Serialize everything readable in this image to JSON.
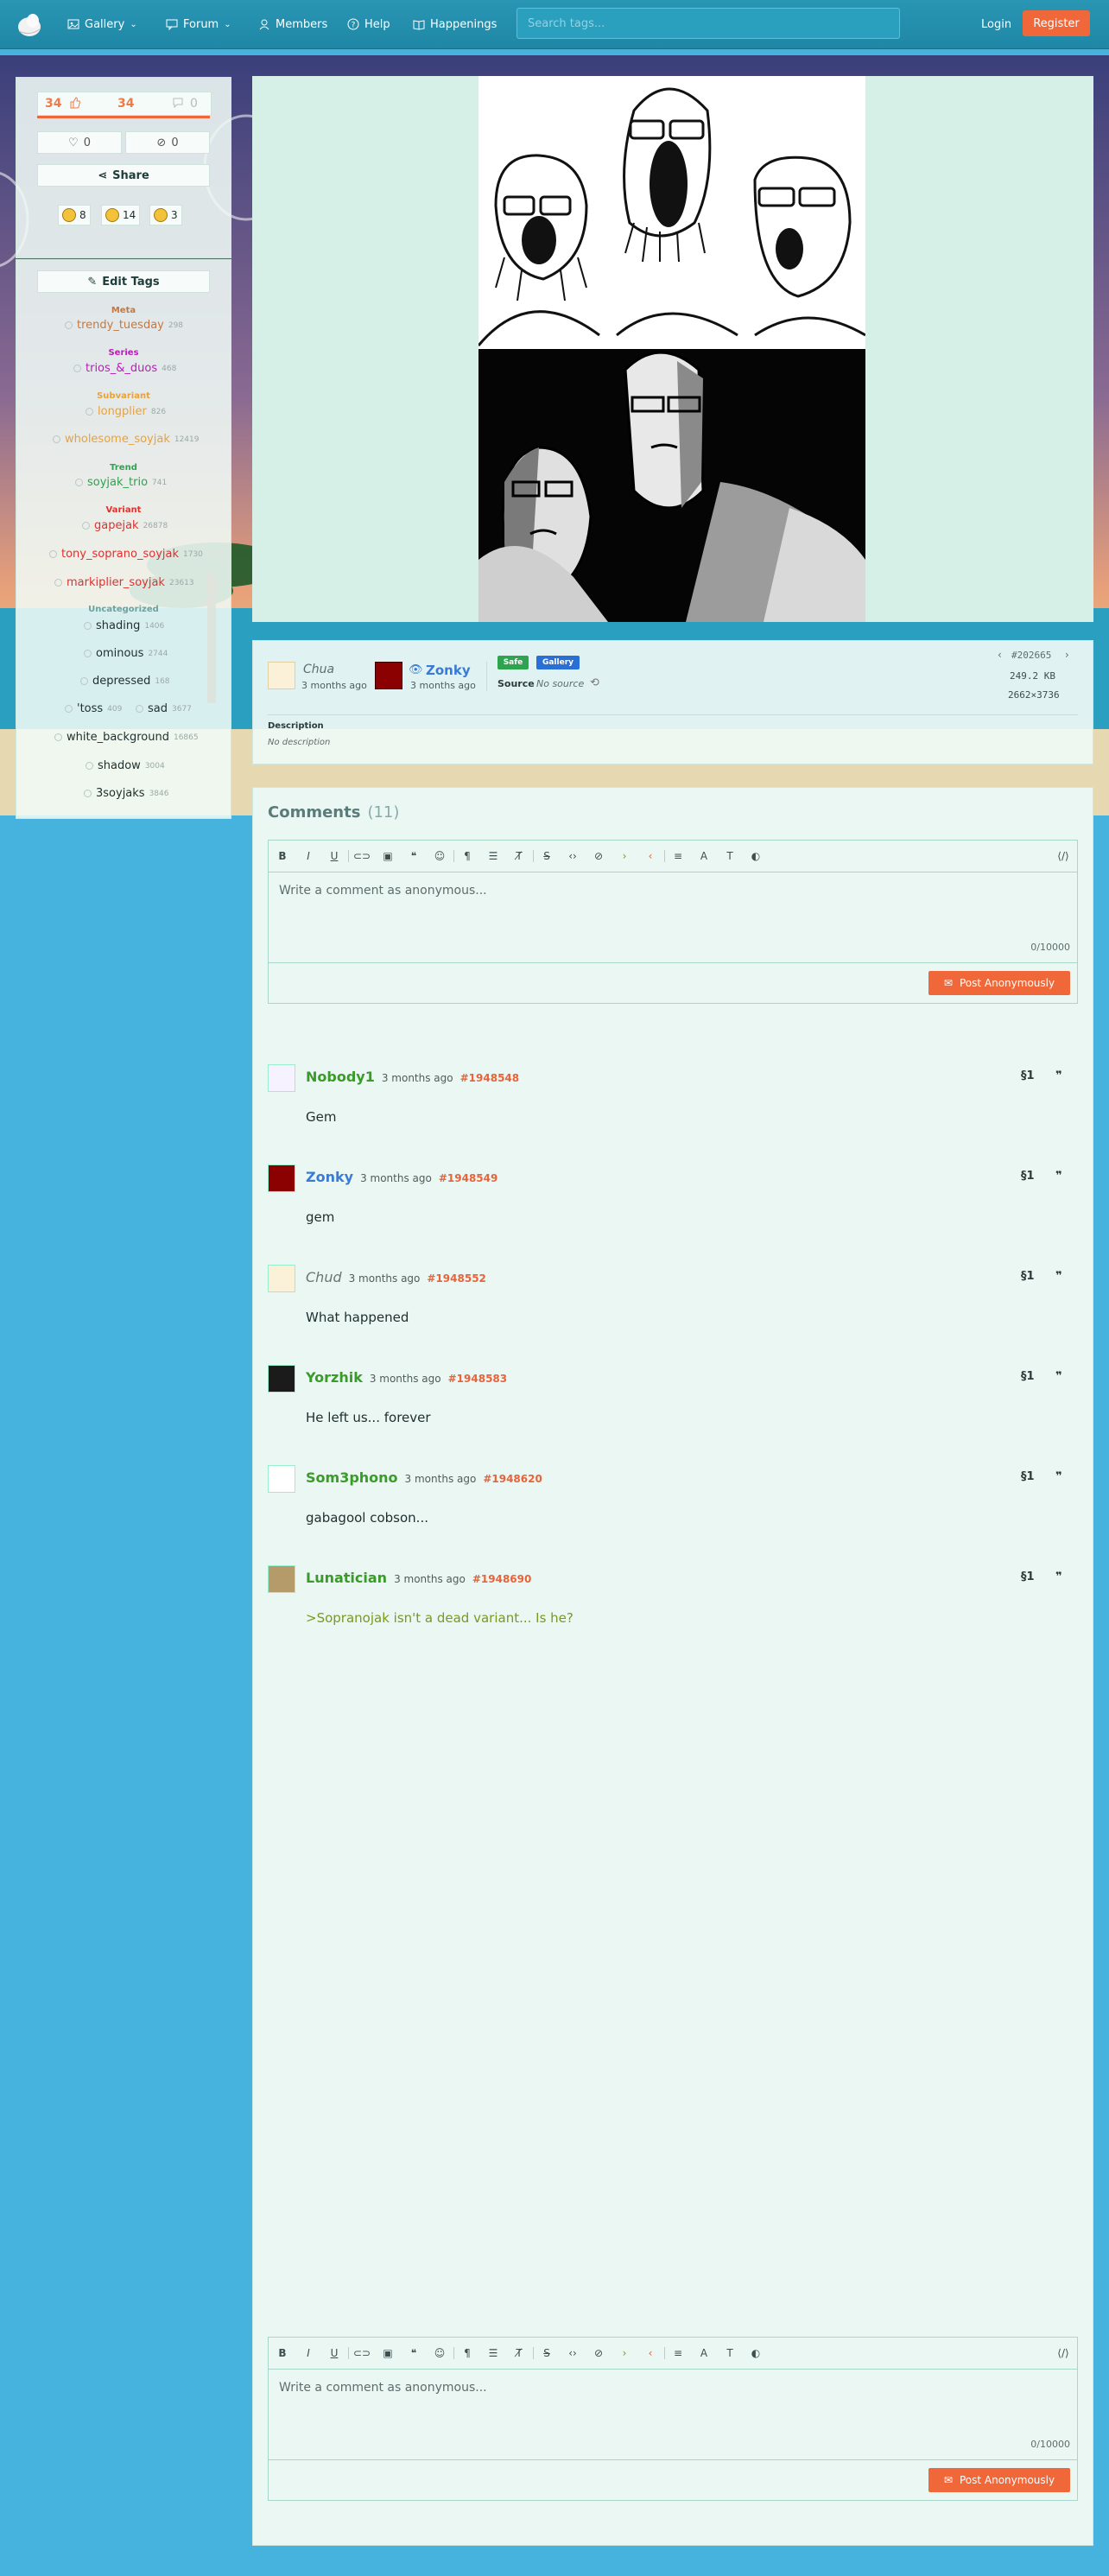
{
  "nav": {
    "items": [
      {
        "label": "Gallery",
        "icon": "image-icon",
        "caret": true
      },
      {
        "label": "Forum",
        "icon": "message-icon",
        "caret": true
      },
      {
        "label": "Members",
        "icon": "user-icon",
        "caret": false
      },
      {
        "label": "Help",
        "icon": "help-icon",
        "caret": false
      },
      {
        "label": "Happenings",
        "icon": "book-icon",
        "caret": false
      }
    ],
    "search_placeholder": "Search tags...",
    "login": "Login",
    "register": "Register"
  },
  "votes": {
    "score": "34",
    "upvotes": "34",
    "downvotes": "0",
    "favorites": "0",
    "hidden": "0",
    "share": "Share"
  },
  "reactions": [
    {
      "icon": "happy-face-icon",
      "count": "8"
    },
    {
      "icon": "laugh-face-icon",
      "count": "14"
    },
    {
      "icon": "cool-face-icon",
      "count": "3"
    }
  ],
  "tags": {
    "edit_label": "Edit Tags",
    "categories": {
      "meta": "Meta",
      "series": "Series",
      "subvariant": "Subvariant",
      "trend": "Trend",
      "variant": "Variant",
      "uncategorized": "Uncategorized"
    },
    "items": {
      "trendy_tuesday": {
        "name": "trendy_tuesday",
        "count": "298"
      },
      "trios_duos": {
        "name": "trios_&_duos",
        "count": "468"
      },
      "longplier": {
        "name": "longplier",
        "count": "826"
      },
      "wholesome": {
        "name": "wholesome_soyjak",
        "count": "12419"
      },
      "soyjak_trio": {
        "name": "soyjak_trio",
        "count": "741"
      },
      "gapejak": {
        "name": "gapejak",
        "count": "26878"
      },
      "tony": {
        "name": "tony_soprano_soyjak",
        "count": "1730"
      },
      "markiplier": {
        "name": "markiplier_soyjak",
        "count": "23613"
      },
      "shading": {
        "name": "shading",
        "count": "1406"
      },
      "ominous": {
        "name": "ominous",
        "count": "2744"
      },
      "depressed": {
        "name": "depressed",
        "count": "168"
      },
      "toss": {
        "name": "'toss",
        "count": "409"
      },
      "sad": {
        "name": "sad",
        "count": "3677"
      },
      "white_background": {
        "name": "white_background",
        "count": "16865"
      },
      "shadow": {
        "name": "shadow",
        "count": "3004"
      },
      "3soyjaks": {
        "name": "3soyjaks",
        "count": "3846"
      }
    },
    "colors": {
      "meta": "#c7773d",
      "series": "#b51fb5",
      "subvariant": "#e8a23a",
      "trend": "#2da34f",
      "variant": "#e0302d",
      "general": "#1f2f2e",
      "uncat_header": "#6aa3a0"
    }
  },
  "post": {
    "uploader": "Chua",
    "uploader_time": "3 months ago",
    "approver": "Zonky",
    "approver_time": "3 months ago",
    "rating_badge": "Safe",
    "gallery_badge": "Gallery",
    "source_label": "Source",
    "source_value": "No source",
    "id": "#202665",
    "filesize": "249.2 KB",
    "dimensions": "2662×3736",
    "description_label": "Description",
    "description_value": "No description"
  },
  "comments": {
    "title": "Comments",
    "count": "(11)",
    "placeholder": "Write a comment as anonymous...",
    "char_count": "0/10000",
    "post_label": "Post Anonymously",
    "items": [
      {
        "user": "Nobody1",
        "time": "3 months ago",
        "id": "#1948548",
        "body": "Gem",
        "user_color": "#3a9a2a"
      },
      {
        "user": "Zonky",
        "time": "3 months ago",
        "id": "#1948549",
        "body": "gem",
        "user_color": "#3a7bd5"
      },
      {
        "user": "Chud",
        "time": "3 months ago",
        "id": "#1948552",
        "body": "What happened",
        "user_color": "#6a7574"
      },
      {
        "user": "Yorzhik",
        "time": "3 months ago",
        "id": "#1948583",
        "body": "He left us... forever",
        "user_color": "#3a9a2a"
      },
      {
        "user": "Som3phono",
        "time": "3 months ago",
        "id": "#1948620",
        "body": "gabagool cobson...",
        "user_color": "#3a9a2a"
      },
      {
        "user": "Lunatician",
        "time": "3 months ago",
        "id": "#1948690",
        "body": ">Sopranojak isn't a dead variant... Is he?",
        "user_color": "#3a9a2a",
        "body_color": "#789922"
      }
    ]
  }
}
